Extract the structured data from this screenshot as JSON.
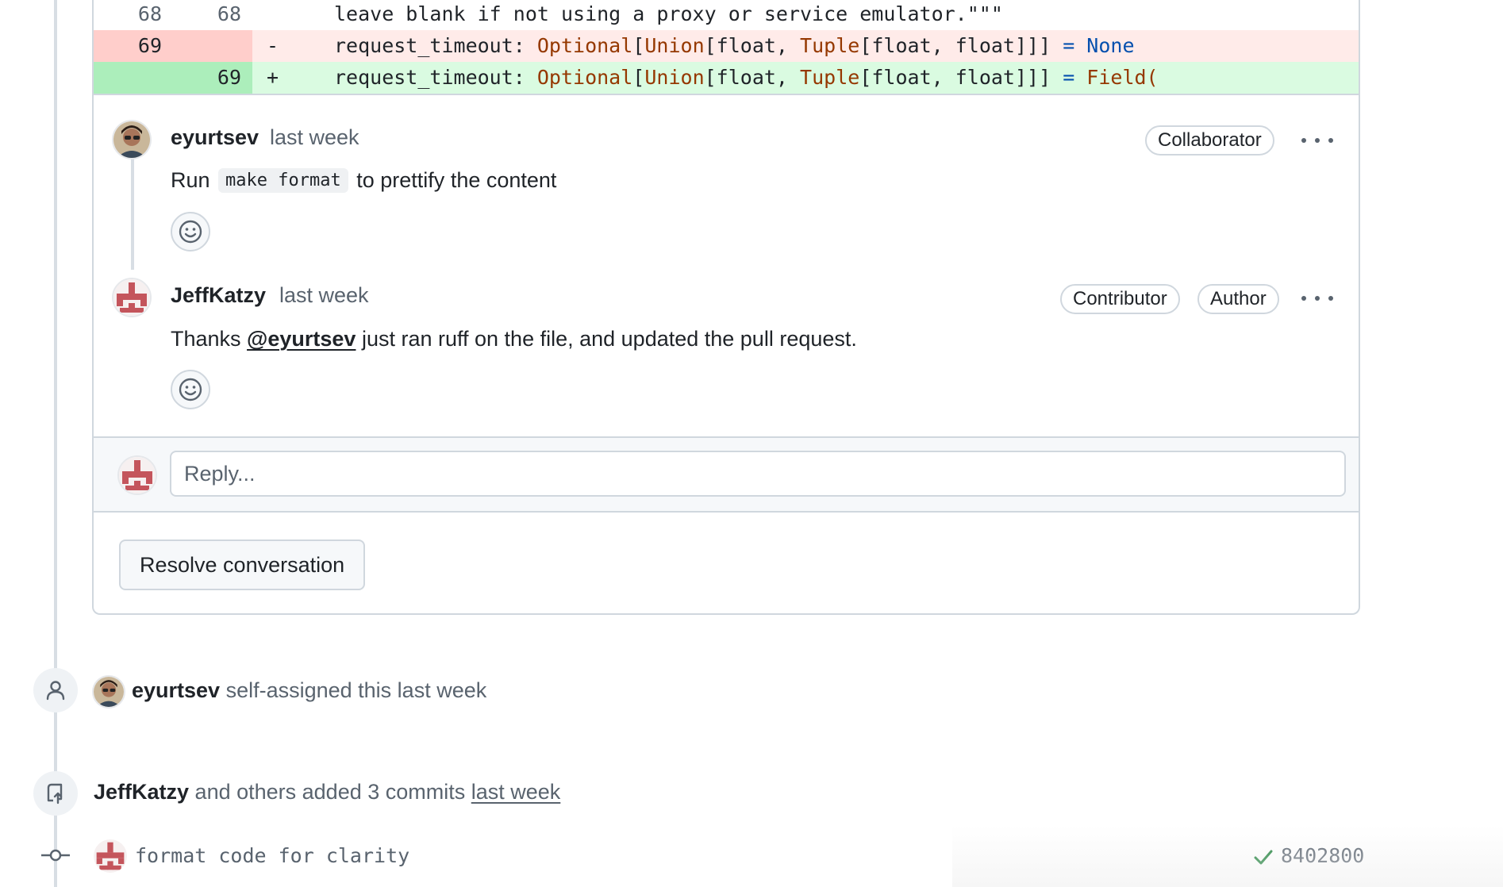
{
  "diff": {
    "context_row": {
      "old_line": "68",
      "new_line": "68",
      "code": "leave blank if not using a proxy or service emulator.\"\"\""
    },
    "deleted_row": {
      "old_line": "69",
      "sign": "-",
      "code_prefix": "request_timeout: ",
      "code_type1": "Optional",
      "code_b1": "[",
      "code_type2": "Union",
      "code_b2": "[float, ",
      "code_type3": "Tuple",
      "code_b3": "[float, float]]] ",
      "code_op": "=",
      "code_value": " None"
    },
    "added_row": {
      "new_line": "69",
      "sign": "+",
      "code_prefix": "request_timeout: ",
      "code_type1": "Optional",
      "code_b1": "[",
      "code_type2": "Union",
      "code_b2": "[float, ",
      "code_type3": "Tuple",
      "code_b3": "[float, float]]] ",
      "code_op": "=",
      "code_value": " Field("
    }
  },
  "comments": [
    {
      "author": "eyurtsev",
      "time": "last week",
      "badges": [
        "Collaborator"
      ],
      "body_before": "Run",
      "body_code": "make format",
      "body_after": "to prettify the content"
    },
    {
      "author": "JeffKatzy",
      "time": "last week",
      "badges": [
        "Contributor",
        "Author"
      ],
      "body_before": "Thanks ",
      "body_mention": "@eyurtsev",
      "body_after": " just ran ruff on the file, and updated the pull request."
    }
  ],
  "reply": {
    "placeholder": "Reply..."
  },
  "resolve_button": "Resolve conversation",
  "events": {
    "self_assign": {
      "actor": "eyurtsev",
      "text": " self-assigned this last week"
    },
    "commits": {
      "actor": "JeffKatzy",
      "text": " and others added 3 commits ",
      "time_link": "last week"
    }
  },
  "commit": {
    "message": "format code for clarity",
    "sha": "8402800",
    "status": "check-icon"
  },
  "colors": {
    "deleted_bg": "#ffebe9",
    "added_bg": "#dafbe1",
    "type_token": "#953800",
    "keyword_token": "#0550ae",
    "success": "#1a7f37"
  }
}
